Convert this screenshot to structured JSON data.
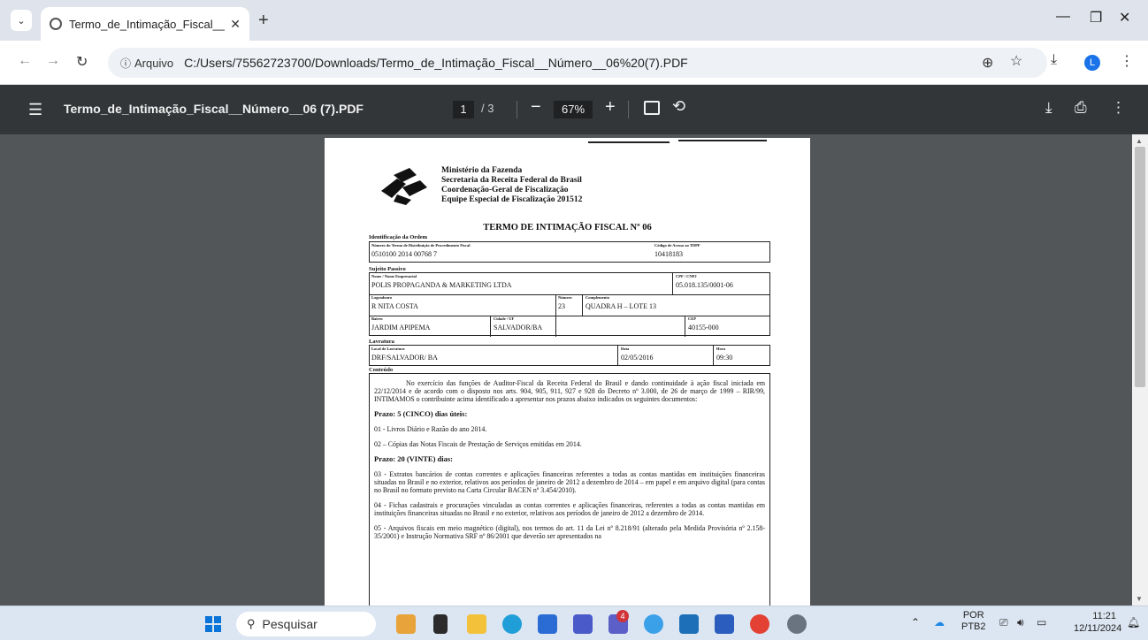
{
  "browser": {
    "tab_title": "Termo_de_Intimação_Fiscal__N",
    "tab_close": "✕",
    "new_tab": "+",
    "address_info_label": "Arquivo",
    "url": "C:/Users/75562723700/Downloads/Termo_de_Intimação_Fiscal__Número__06%20(7).PDF",
    "profile_initial": "L"
  },
  "pdf_toolbar": {
    "file_name": "Termo_de_Intimação_Fiscal__Número__06 (7).PDF",
    "current_page": "1",
    "total_pages": "/  3",
    "zoom": "67%"
  },
  "document": {
    "header": {
      "line1": "Ministério da Fazenda",
      "line2": "Secretaria da Receita Federal do Brasil",
      "line3": "Coordenação-Geral de Fiscalização",
      "line4": "Equipe Especial de Fiscalização 201512"
    },
    "title": "TERMO DE INTIMAÇÃO FISCAL Nº 06",
    "identificacao": {
      "section": "Identificação da Ordem",
      "tdpf_label": "Número do Termo de Distribuição de Procedimento Fiscal",
      "tdpf_value": "0510100 2014 00768 7",
      "codigo_label": "Código de Acesso ao TDPF",
      "codigo_value": "10418183"
    },
    "sujeito": {
      "section": "Sujeito Passivo",
      "nome_label": "Nome / Nome Empresarial",
      "nome_value": "POLIS PROPAGANDA & MARKETING LTDA",
      "cpf_label": "CPF / CNPJ",
      "cpf_value": "05.018.135/0001-06",
      "logradouro_label": "Logradouro",
      "logradouro_value": "R NITA COSTA",
      "numero_label": "Número",
      "numero_value": "23",
      "complemento_label": "Complemento",
      "complemento_value": "QUADRA H – LOTE 13",
      "bairro_label": "Bairro",
      "bairro_value": "JARDIM APIPEMA",
      "cidade_label": "Cidade / UF",
      "cidade_value": "SALVADOR/BA",
      "cep_label": "CEP",
      "cep_value": "40155-000"
    },
    "lavratura": {
      "section": "Lavratura",
      "local_label": "Local de Lavratura",
      "local_value": "DRF/SALVADOR/ BA",
      "data_label": "Data",
      "data_value": "02/05/2016",
      "hora_label": "Hora",
      "hora_value": "09:30"
    },
    "conteudo": {
      "section": "Conteúdo",
      "intro": "No exercício das funções de Auditor-Fiscal da Receita Federal do Brasil e dando continuidade à ação fiscal iniciada em 22/12/2014 e de acordo com o disposto nos arts. 904, 905, 911, 927 e 928 do Decreto nº 3.000, de 26 de março de 1999 – RIR/99, INTIMAMOS o contribuinte acima identificado a apresentar nos prazos abaixo indicados os seguintes documentos:",
      "prazo1": "Prazo: 5 (CINCO) dias úteis:",
      "item01": "01 - Livros Diário e Razão do ano 2014.",
      "item02": "02 – Cópias das Notas Fiscais de Prestação de Serviços emitidas em 2014.",
      "prazo2": "Prazo: 20 (VINTE) dias:",
      "item03": "03 - Extratos bancários de contas correntes e aplicações financeiras referentes a todas as contas mantidas em instituições financeiras situadas no Brasil e no exterior, relativos aos períodos de janeiro de 2012 a dezembro de 2014 – em papel e em arquivo digital (para contas no Brasil no formato previsto na Carta Circular BACEN nº 3.454/2010).",
      "item04": "04 - Fichas cadastrais e procurações vinculadas as contas correntes e aplicações financeiras, referentes a todas as contas mantidas em instituições financeiras situadas no Brasil e no exterior, relativos aos períodos de janeiro de 2012 a dezembro de 2014.",
      "item05": "05 - Arquivos fiscais em meio magnético (digital), nos termos do art. 11 da Lei nº 8.218/91 (alterado pela Medida Provisória nº 2.158-35/2001) e Instrução Normativa SRF nº 86/2001 que deverão ser apresentados na"
    }
  },
  "taskbar": {
    "search_placeholder": "Pesquisar",
    "teams_badge": "4",
    "lang_line1": "POR",
    "lang_line2": "PTB2",
    "time": "11:21",
    "date": "12/11/2024"
  }
}
